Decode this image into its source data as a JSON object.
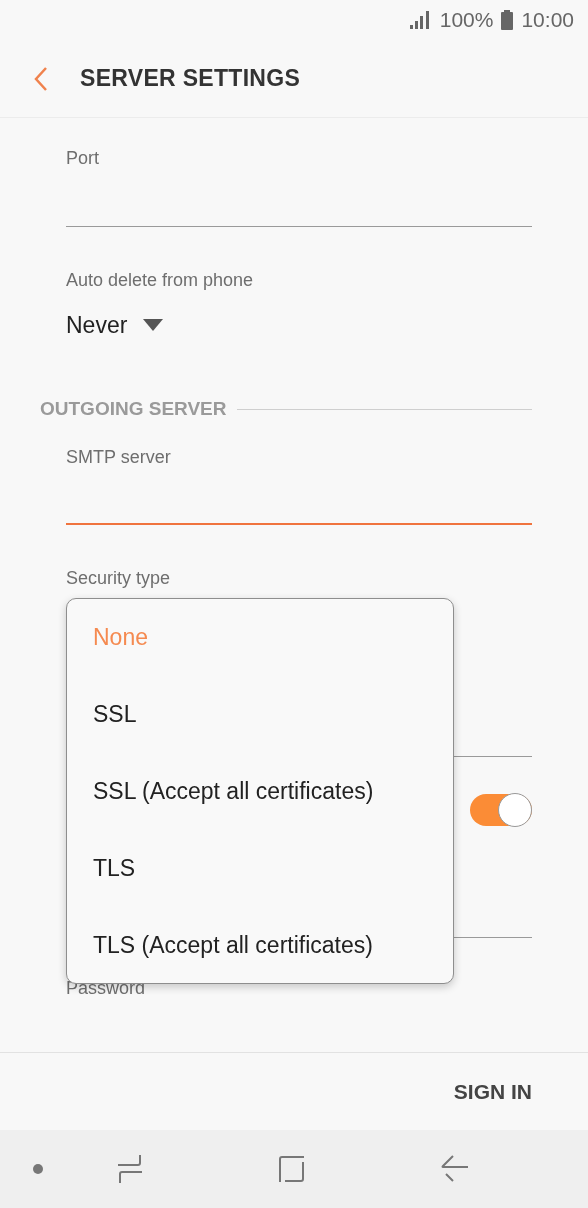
{
  "status_bar": {
    "battery": "100%",
    "time": "10:00"
  },
  "app_bar": {
    "title": "SERVER SETTINGS"
  },
  "fields": [
    {
      "label": "Port"
    }
  ],
  "auto_delete": {
    "label": "Auto delete from phone",
    "value": "Never"
  },
  "outgoing_section": {
    "title": "OUTGOING SERVER"
  },
  "smtp_field": {
    "label": "SMTP server",
    "focused": true
  },
  "security_type": {
    "label": "Security type"
  },
  "toggle": {
    "on": true
  },
  "password": {
    "label": "Password"
  },
  "security_menu": [
    {
      "label": "None",
      "selected": true
    },
    {
      "label": "SSL",
      "selected": false
    },
    {
      "label": "SSL (Accept all certificates)",
      "selected": false
    },
    {
      "label": "TLS",
      "selected": false
    },
    {
      "label": "TLS (Accept all certificates)",
      "selected": false
    }
  ],
  "footer": {
    "button": "SIGN IN"
  }
}
